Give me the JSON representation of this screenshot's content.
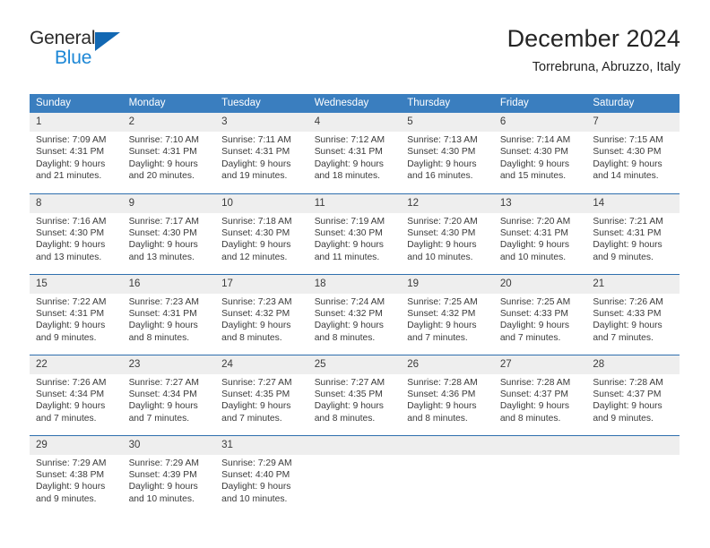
{
  "brand": {
    "name_part1": "General",
    "name_part2": "Blue",
    "triangle_icon": "triangle-icon",
    "accent_color": "#1268b3",
    "blue_text_color": "#1c87d6"
  },
  "header": {
    "title": "December 2024",
    "subtitle": "Torrebruna, Abruzzo, Italy"
  },
  "theme": {
    "header_row_bg": "#3a7ebf",
    "daynum_bg": "#eeeeee",
    "week_divider": "#2f6fae",
    "text_color": "#3a3a3a"
  },
  "weekday_headers": [
    "Sunday",
    "Monday",
    "Tuesday",
    "Wednesday",
    "Thursday",
    "Friday",
    "Saturday"
  ],
  "weeks": [
    [
      {
        "day": "1",
        "lines": [
          "Sunrise: 7:09 AM",
          "Sunset: 4:31 PM",
          "Daylight: 9 hours",
          "and 21 minutes."
        ]
      },
      {
        "day": "2",
        "lines": [
          "Sunrise: 7:10 AM",
          "Sunset: 4:31 PM",
          "Daylight: 9 hours",
          "and 20 minutes."
        ]
      },
      {
        "day": "3",
        "lines": [
          "Sunrise: 7:11 AM",
          "Sunset: 4:31 PM",
          "Daylight: 9 hours",
          "and 19 minutes."
        ]
      },
      {
        "day": "4",
        "lines": [
          "Sunrise: 7:12 AM",
          "Sunset: 4:31 PM",
          "Daylight: 9 hours",
          "and 18 minutes."
        ]
      },
      {
        "day": "5",
        "lines": [
          "Sunrise: 7:13 AM",
          "Sunset: 4:30 PM",
          "Daylight: 9 hours",
          "and 16 minutes."
        ]
      },
      {
        "day": "6",
        "lines": [
          "Sunrise: 7:14 AM",
          "Sunset: 4:30 PM",
          "Daylight: 9 hours",
          "and 15 minutes."
        ]
      },
      {
        "day": "7",
        "lines": [
          "Sunrise: 7:15 AM",
          "Sunset: 4:30 PM",
          "Daylight: 9 hours",
          "and 14 minutes."
        ]
      }
    ],
    [
      {
        "day": "8",
        "lines": [
          "Sunrise: 7:16 AM",
          "Sunset: 4:30 PM",
          "Daylight: 9 hours",
          "and 13 minutes."
        ]
      },
      {
        "day": "9",
        "lines": [
          "Sunrise: 7:17 AM",
          "Sunset: 4:30 PM",
          "Daylight: 9 hours",
          "and 13 minutes."
        ]
      },
      {
        "day": "10",
        "lines": [
          "Sunrise: 7:18 AM",
          "Sunset: 4:30 PM",
          "Daylight: 9 hours",
          "and 12 minutes."
        ]
      },
      {
        "day": "11",
        "lines": [
          "Sunrise: 7:19 AM",
          "Sunset: 4:30 PM",
          "Daylight: 9 hours",
          "and 11 minutes."
        ]
      },
      {
        "day": "12",
        "lines": [
          "Sunrise: 7:20 AM",
          "Sunset: 4:30 PM",
          "Daylight: 9 hours",
          "and 10 minutes."
        ]
      },
      {
        "day": "13",
        "lines": [
          "Sunrise: 7:20 AM",
          "Sunset: 4:31 PM",
          "Daylight: 9 hours",
          "and 10 minutes."
        ]
      },
      {
        "day": "14",
        "lines": [
          "Sunrise: 7:21 AM",
          "Sunset: 4:31 PM",
          "Daylight: 9 hours",
          "and 9 minutes."
        ]
      }
    ],
    [
      {
        "day": "15",
        "lines": [
          "Sunrise: 7:22 AM",
          "Sunset: 4:31 PM",
          "Daylight: 9 hours",
          "and 9 minutes."
        ]
      },
      {
        "day": "16",
        "lines": [
          "Sunrise: 7:23 AM",
          "Sunset: 4:31 PM",
          "Daylight: 9 hours",
          "and 8 minutes."
        ]
      },
      {
        "day": "17",
        "lines": [
          "Sunrise: 7:23 AM",
          "Sunset: 4:32 PM",
          "Daylight: 9 hours",
          "and 8 minutes."
        ]
      },
      {
        "day": "18",
        "lines": [
          "Sunrise: 7:24 AM",
          "Sunset: 4:32 PM",
          "Daylight: 9 hours",
          "and 8 minutes."
        ]
      },
      {
        "day": "19",
        "lines": [
          "Sunrise: 7:25 AM",
          "Sunset: 4:32 PM",
          "Daylight: 9 hours",
          "and 7 minutes."
        ]
      },
      {
        "day": "20",
        "lines": [
          "Sunrise: 7:25 AM",
          "Sunset: 4:33 PM",
          "Daylight: 9 hours",
          "and 7 minutes."
        ]
      },
      {
        "day": "21",
        "lines": [
          "Sunrise: 7:26 AM",
          "Sunset: 4:33 PM",
          "Daylight: 9 hours",
          "and 7 minutes."
        ]
      }
    ],
    [
      {
        "day": "22",
        "lines": [
          "Sunrise: 7:26 AM",
          "Sunset: 4:34 PM",
          "Daylight: 9 hours",
          "and 7 minutes."
        ]
      },
      {
        "day": "23",
        "lines": [
          "Sunrise: 7:27 AM",
          "Sunset: 4:34 PM",
          "Daylight: 9 hours",
          "and 7 minutes."
        ]
      },
      {
        "day": "24",
        "lines": [
          "Sunrise: 7:27 AM",
          "Sunset: 4:35 PM",
          "Daylight: 9 hours",
          "and 7 minutes."
        ]
      },
      {
        "day": "25",
        "lines": [
          "Sunrise: 7:27 AM",
          "Sunset: 4:35 PM",
          "Daylight: 9 hours",
          "and 8 minutes."
        ]
      },
      {
        "day": "26",
        "lines": [
          "Sunrise: 7:28 AM",
          "Sunset: 4:36 PM",
          "Daylight: 9 hours",
          "and 8 minutes."
        ]
      },
      {
        "day": "27",
        "lines": [
          "Sunrise: 7:28 AM",
          "Sunset: 4:37 PM",
          "Daylight: 9 hours",
          "and 8 minutes."
        ]
      },
      {
        "day": "28",
        "lines": [
          "Sunrise: 7:28 AM",
          "Sunset: 4:37 PM",
          "Daylight: 9 hours",
          "and 9 minutes."
        ]
      }
    ],
    [
      {
        "day": "29",
        "lines": [
          "Sunrise: 7:29 AM",
          "Sunset: 4:38 PM",
          "Daylight: 9 hours",
          "and 9 minutes."
        ]
      },
      {
        "day": "30",
        "lines": [
          "Sunrise: 7:29 AM",
          "Sunset: 4:39 PM",
          "Daylight: 9 hours",
          "and 10 minutes."
        ]
      },
      {
        "day": "31",
        "lines": [
          "Sunrise: 7:29 AM",
          "Sunset: 4:40 PM",
          "Daylight: 9 hours",
          "and 10 minutes."
        ]
      },
      {
        "day": "",
        "lines": []
      },
      {
        "day": "",
        "lines": []
      },
      {
        "day": "",
        "lines": []
      },
      {
        "day": "",
        "lines": []
      }
    ]
  ]
}
